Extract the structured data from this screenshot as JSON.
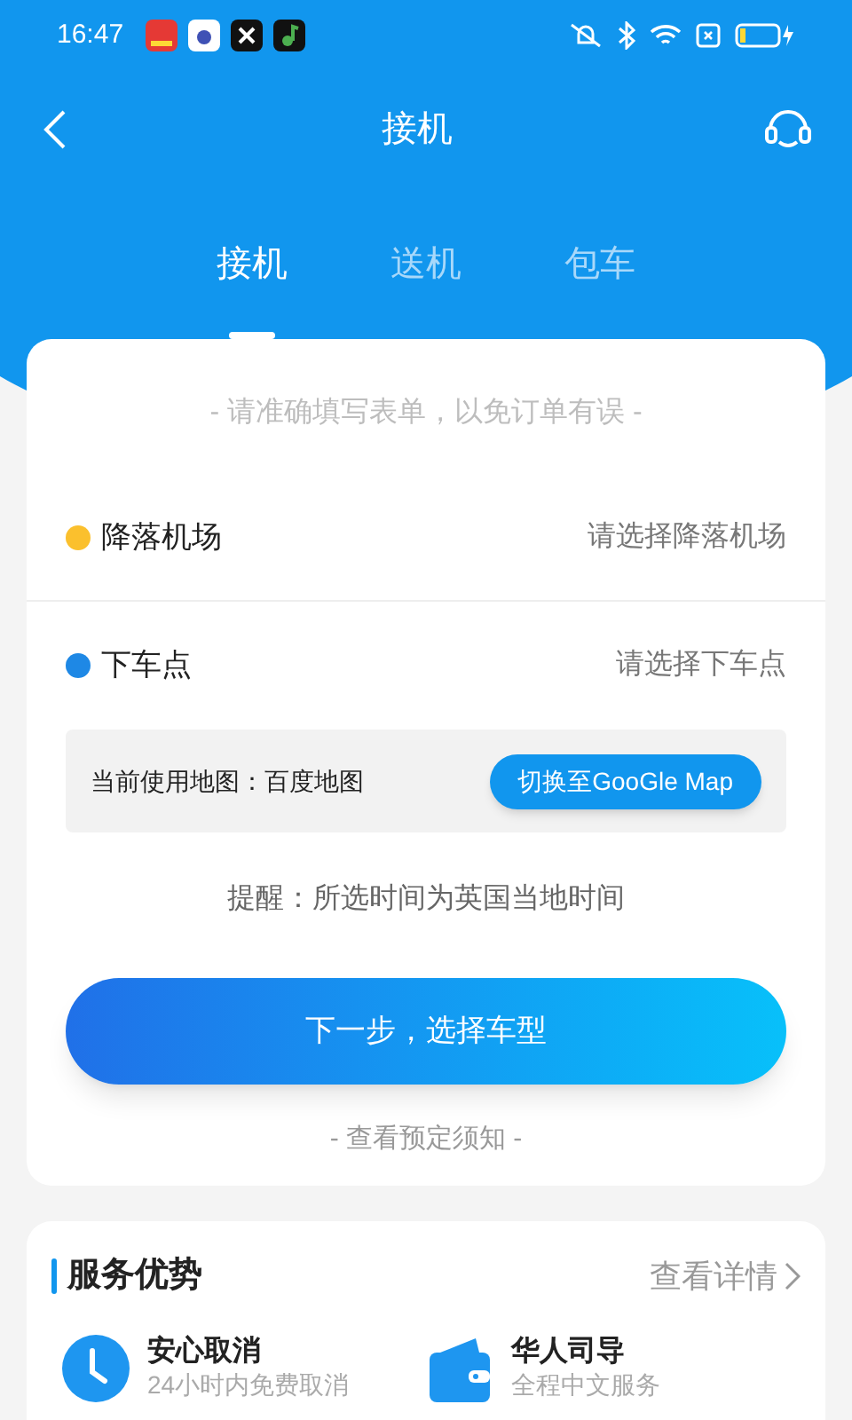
{
  "status_bar": {
    "time": "16:47"
  },
  "nav": {
    "title": "接机"
  },
  "tabs": [
    {
      "label": "接机",
      "selected": true
    },
    {
      "label": "送机",
      "selected": false
    },
    {
      "label": "包车",
      "selected": false
    }
  ],
  "form": {
    "hint": "- 请准确填写表单，以免订单有误 -",
    "locations": [
      {
        "label": "降落机场",
        "placeholder": "请选择降落机场",
        "color": "#fbc02d"
      },
      {
        "label": "下车点",
        "placeholder": "请选择下车点",
        "color": "#1e88e5"
      }
    ],
    "map": {
      "current": "当前使用地图：百度地图",
      "switch_button": "切换至GooGle Map"
    },
    "reminder": "提醒：所选时间为英国当地时间",
    "next_button": "下一步，选择车型",
    "notice_link": "- 查看预定须知 -"
  },
  "services": {
    "title": "服务优势",
    "more": "查看详情",
    "features": [
      {
        "kind": "clock",
        "title": "安心取消",
        "subtitle": "24小时内免费取消"
      },
      {
        "kind": "wallet",
        "title": "华人司导",
        "subtitle": "全程中文服务"
      }
    ]
  }
}
